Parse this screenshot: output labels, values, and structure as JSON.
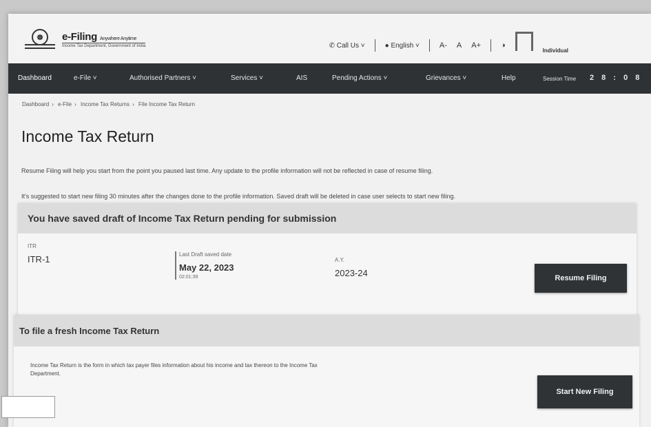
{
  "header": {
    "brand": "e-Filing",
    "brand_tag": "Anywhere Anytime",
    "dept": "Income Tax Department, Government of India",
    "call_us": "Call Us",
    "language": "English",
    "font_small": "A-",
    "font_normal": "A",
    "font_large": "A+",
    "user_name": "Individual"
  },
  "nav": {
    "items": [
      {
        "label": "Dashboard"
      },
      {
        "label": "e-File ˅"
      },
      {
        "label": "Authorised Partners ˅"
      },
      {
        "label": "Services ˅"
      },
      {
        "label": "AIS"
      },
      {
        "label": "Pending Actions ˅"
      },
      {
        "label": "Grievances ˅"
      },
      {
        "label": "Help"
      }
    ],
    "session_label": "Session Time",
    "session_time": "2 8 : 0 8"
  },
  "breadcrumb": [
    "Dashboard",
    "e-File",
    "Income Tax Returns",
    "File Income Tax Return"
  ],
  "page": {
    "title": "Income Tax Return",
    "info1": "Resume Filing will help you start from the point you paused last time. Any update to the profile information will not be reflected in case of resume filing.",
    "info2": "It's suggested to start new filing 30 minutes after the changes done to the profile information. Saved draft will be deleted in case user selects to start new filing."
  },
  "draft": {
    "heading": "You have saved draft of Income Tax Return pending for submission",
    "itr_label": "ITR",
    "itr_value": "ITR-1",
    "saved_label": "Last Draft saved date",
    "saved_date": "May 22, 2023",
    "saved_time": "02:01:39",
    "ay_label": "A.Y.",
    "ay_value": "2023-24",
    "resume_button": "Resume Filing"
  },
  "fresh": {
    "heading": "To file a fresh Income Tax Return",
    "description": "Income Tax Return is the form in which tax payer files information about his income and tax thereon to the Income Tax Department.",
    "start_button": "Start New Filing"
  }
}
